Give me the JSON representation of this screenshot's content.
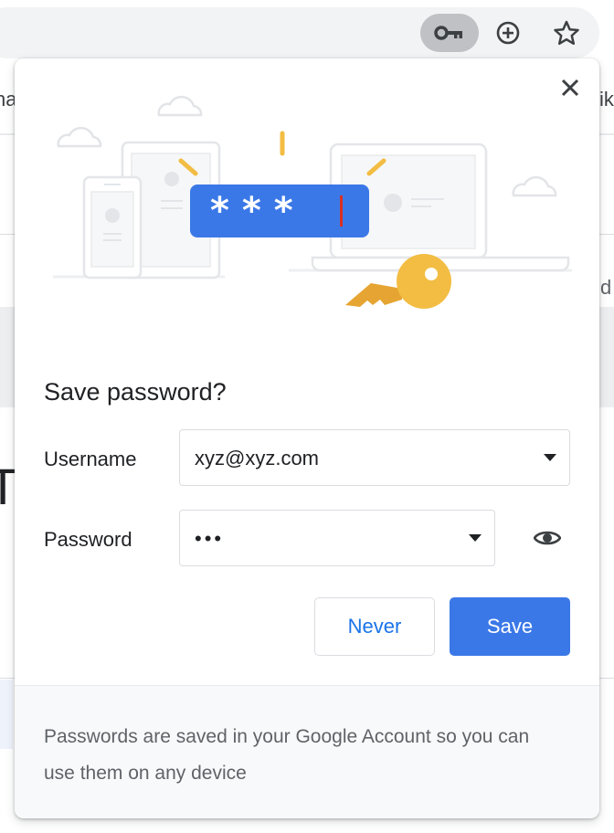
{
  "toolbar": {
    "buttons": [
      {
        "name": "key-icon",
        "active": true
      },
      {
        "name": "add-circle-icon",
        "active": false
      },
      {
        "name": "star-icon",
        "active": false
      }
    ]
  },
  "background_page": {
    "left_edge_texts": [
      "ha",
      "T"
    ],
    "right_edge_texts": [
      "ik",
      "d"
    ]
  },
  "illustration": {
    "masked_password": "* * *",
    "accent_colors": {
      "blue": "#3b78e7",
      "yellow": "#f2bd42",
      "red": "#d93025"
    }
  },
  "dialog": {
    "title": "Save password?",
    "username": {
      "label": "Username",
      "value": "xyz@xyz.com"
    },
    "password": {
      "label": "Password",
      "value": "•••"
    },
    "never_label": "Never",
    "save_label": "Save",
    "footer_text": "Passwords are saved in your Google Account so you can use them on any device"
  },
  "colors": {
    "primary": "#3b78e7",
    "link": "#1a73e8",
    "text": "#202124",
    "secondary_text": "#5f6368",
    "footer_bg": "#f8f9fa"
  }
}
